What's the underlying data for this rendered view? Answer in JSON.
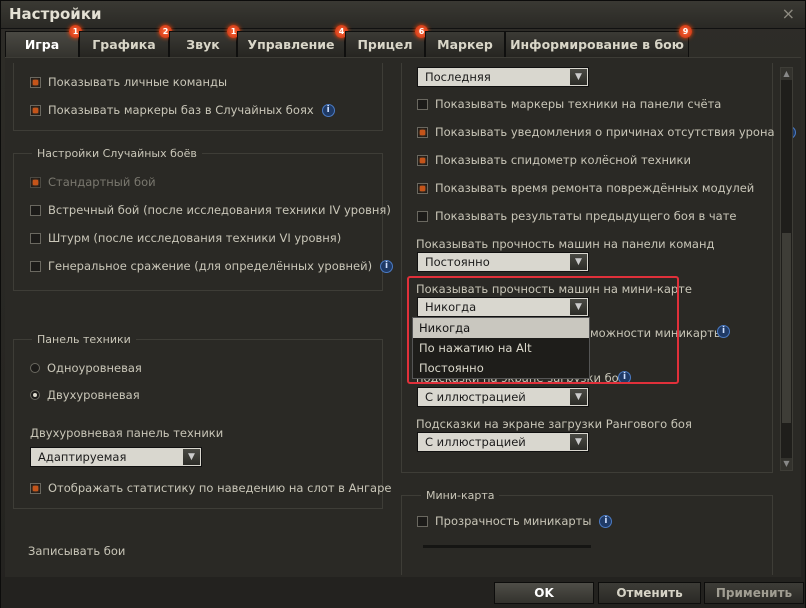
{
  "window": {
    "title": "Настройки",
    "close_glyph": "×"
  },
  "tabs": [
    {
      "label": "Игра",
      "badge": "1",
      "active": true
    },
    {
      "label": "Графика",
      "badge": "2"
    },
    {
      "label": "Звук",
      "badge": "1"
    },
    {
      "label": "Управление",
      "badge": "4"
    },
    {
      "label": "Прицел",
      "badge": "6"
    },
    {
      "label": "Маркер",
      "badge": ""
    },
    {
      "label": "Информирование в бою",
      "badge": "9"
    }
  ],
  "left": {
    "top_checks": [
      {
        "label": "Показывать личные команды",
        "checked": true
      },
      {
        "label": "Показывать маркеры баз в Случайных боях",
        "checked": true,
        "info": "i"
      }
    ],
    "random_battles": {
      "title": "Настройки Случайных боёв",
      "items": [
        {
          "label": "Стандартный бой",
          "checked": true,
          "disabled": true
        },
        {
          "label": "Встречный бой (после исследования техники IV уровня)",
          "checked": false
        },
        {
          "label": "Штурм (после исследования техники VI уровня)",
          "checked": false
        },
        {
          "label": "Генеральное сражение (для определённых уровней)",
          "checked": false,
          "info": "i"
        }
      ]
    },
    "vehicle_panel": {
      "title": "Панель техники",
      "radios": [
        {
          "label": "Одноуровневая",
          "selected": false
        },
        {
          "label": "Двухуровневая",
          "selected": true
        }
      ],
      "two_level_label": "Двухуровневая панель техники",
      "two_level_value": "Адаптируемая",
      "stats_check": {
        "label": "Отображать статистику по наведению на слот в Ангаре",
        "checked": true
      }
    },
    "record_label": "Записывать бои"
  },
  "right": {
    "top_dropdown": "Последняя",
    "checks": [
      {
        "label": "Показывать маркеры техники на панели счёта",
        "checked": false
      },
      {
        "label": "Показывать уведомления о причинах отсутствия урона",
        "checked": true,
        "info": "i"
      },
      {
        "label": "Показывать спидометр колёсной техники",
        "checked": true
      },
      {
        "label": "Показывать время ремонта повреждённых модулей",
        "checked": true
      },
      {
        "label": "Показывать результаты предыдущего боя в чате",
        "checked": false
      }
    ],
    "team_panel_hp": {
      "label": "Показывать прочность машин на панели команд",
      "value": "Постоянно"
    },
    "minimap_hp": {
      "label": "Показывать прочность машин на мини-карте",
      "value": "Никогда",
      "options": [
        "Никогда",
        "По нажатию на Alt",
        "Постоянно"
      ]
    },
    "hidden_partial_1": "можности миникарты",
    "hidden_partial_2": "подсказки на экране загрузки боя",
    "loading_tips": {
      "value": "С иллюстрацией"
    },
    "ranked_tips": {
      "label": "Подсказки на экране загрузки Рангового боя",
      "value": "С иллюстрацией"
    },
    "minimap": {
      "title": "Мини-карта",
      "check": {
        "label": "Прозрачность миникарты",
        "checked": false,
        "info": "i"
      }
    }
  },
  "footer": {
    "ok": "OK",
    "cancel": "Отменить",
    "apply": "Применить"
  },
  "colors": {
    "accent": "#c4541a",
    "highlight": "#e0303a"
  }
}
